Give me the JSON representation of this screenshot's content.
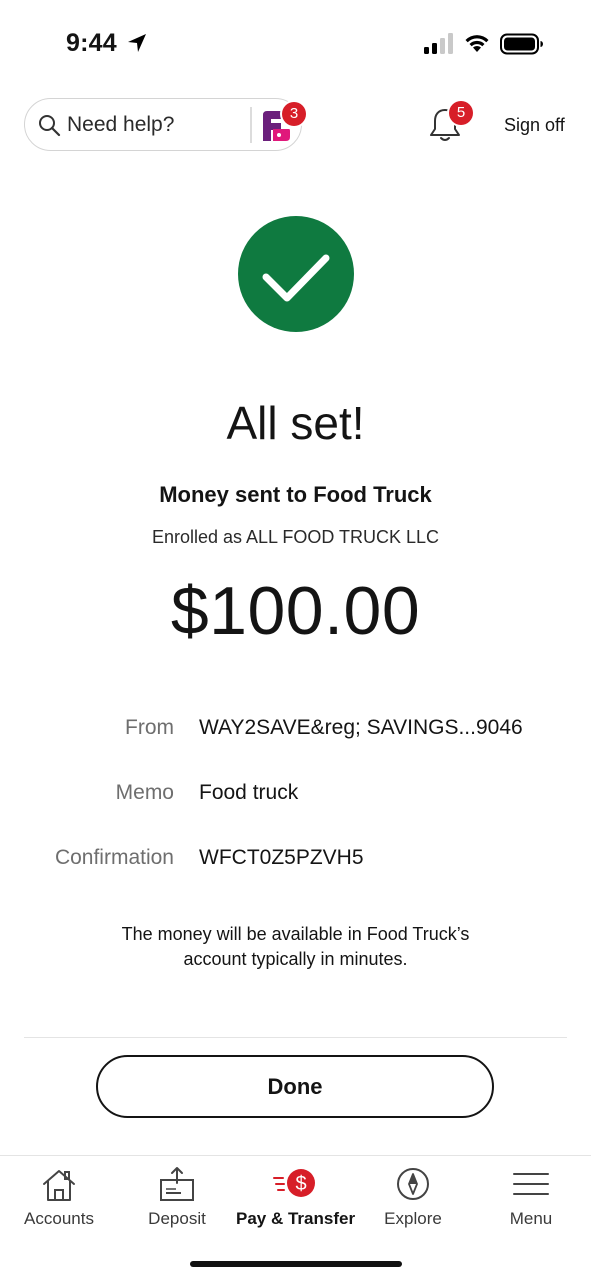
{
  "status_bar": {
    "time": "9:44"
  },
  "header": {
    "search_placeholder": "Need help?",
    "assistant_badge_count": "3",
    "notifications_badge_count": "5",
    "sign_off_label": "Sign off"
  },
  "confirmation": {
    "headline": "All set!",
    "recipient_line": "Money sent to Food Truck",
    "enrolled_line": "Enrolled as ALL FOOD TRUCK LLC",
    "amount": "$100.00",
    "details": [
      {
        "label": "From",
        "value": "WAY2SAVE&reg; SAVINGS...9046"
      },
      {
        "label": "Memo",
        "value": "Food truck"
      },
      {
        "label": "Confirmation",
        "value": "WFCT0Z5PZVH5"
      }
    ],
    "note": "The money will be available in Food Truck’s account typically in minutes.",
    "done_label": "Done"
  },
  "tab_bar": {
    "tabs": [
      {
        "label": "Accounts",
        "icon": "home-icon"
      },
      {
        "label": "Deposit",
        "icon": "deposit-icon"
      },
      {
        "label": "Pay & Transfer",
        "icon": "pay-transfer-icon",
        "active": true
      },
      {
        "label": "Explore",
        "icon": "compass-icon"
      },
      {
        "label": "Menu",
        "icon": "hamburger-menu-icon"
      }
    ]
  },
  "colors": {
    "success_green": "#0f7a40",
    "badge_red": "#d71e28",
    "brand_purple": "#6b1f7c",
    "brand_pink": "#e0187b"
  }
}
